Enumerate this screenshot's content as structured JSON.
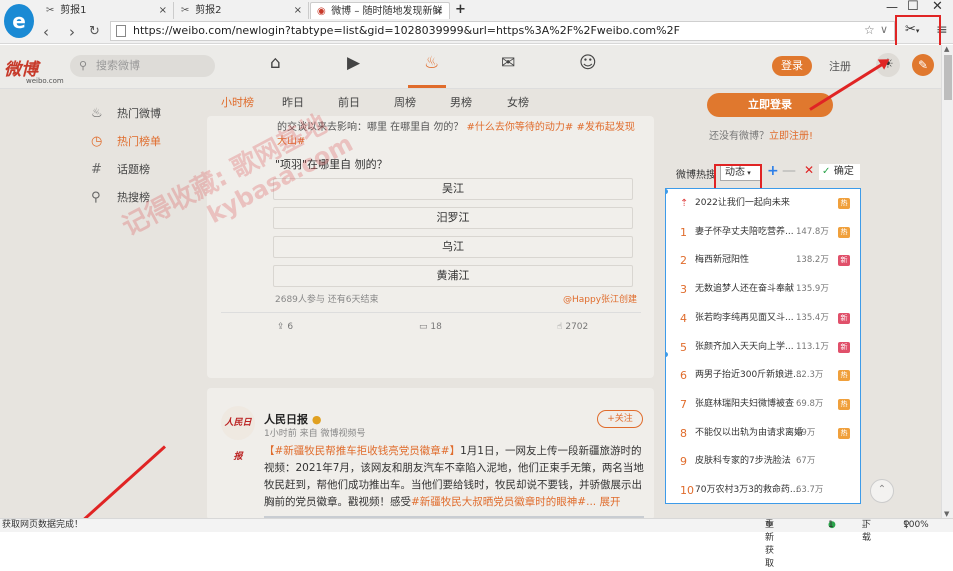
{
  "browser": {
    "tabs": [
      {
        "label": "剪报1",
        "icon": "scissors-icon"
      },
      {
        "label": "剪报2",
        "icon": "scissors-icon"
      },
      {
        "label": "微博 – 随时随地发现新鲜",
        "icon": "weibo-icon"
      }
    ],
    "new_tab": "+",
    "url": "https://weibo.com/newlogin?tabtype=list&gid=1028039999&url=https%3A%2F%2Fweibo.com%2F"
  },
  "weibo": {
    "logo": "微博",
    "logo_sub": "weibo.com",
    "search_placeholder": "搜索微博",
    "login": "登录",
    "register": "注册"
  },
  "sidebar": {
    "items": [
      {
        "label": "热门微博",
        "icon": "fire-icon"
      },
      {
        "label": "热门榜单",
        "icon": "clock-icon"
      },
      {
        "label": "话题榜",
        "icon": "hash-icon"
      },
      {
        "label": "热搜榜",
        "icon": "search-icon"
      }
    ]
  },
  "feed": {
    "tabs": [
      "小时榜",
      "昨日",
      "前日",
      "周榜",
      "男榜",
      "女榜"
    ],
    "poll": {
      "top_line": "的交谈以来去影响：哪里 在哪里自 勿的？",
      "top_line_tag": "#什么去你等待的动力#",
      "top_line_tag2": "#发布起发现",
      "top_line2": "大山#",
      "question": "\"项羽\"在哪里自 刎的？",
      "options": [
        "吴江",
        "汨罗江",
        "乌江",
        "黄浦江"
      ],
      "meta": "2689人参与 还有6天结束",
      "creator": "@Happy张江创建",
      "repost": "6",
      "comment": "18",
      "like": "2702"
    },
    "post": {
      "avatar_text": "人民日报",
      "author": "人民日报",
      "meta": "1小时前 来自 微博视频号",
      "follow": "+关注",
      "text_tag": "【#新疆牧民帮推车拒收钱亮党员徽章#】",
      "text_body": "1月1日，一网友上传一段新疆旅游时的视频：2021年7月，该网友和朋友汽车不幸陷入泥地，他们正束手无策，两名当地牧民赶到，帮他们成功推出车。当他们要给钱时，牧民却说不要钱，并骄傲展示出胸前的党员徽章。戳视频！感受",
      "text_tag2": "#新疆牧民大叔晒党员徽章时的眼神#",
      "more": "... 展开"
    }
  },
  "right": {
    "login_btn": "立即登录",
    "no_account": "还没有微博？",
    "register_link": "立即注册!",
    "hot_title": "微博热搜",
    "dynamic": "动态",
    "confirm": "确定",
    "hot_list": [
      {
        "rank": "",
        "title": "2022让我们一起向未来",
        "count": "",
        "badge": "热"
      },
      {
        "rank": "1",
        "title": "妻子怀孕丈夫陪吃营养...",
        "count": "147.8万",
        "badge": "热"
      },
      {
        "rank": "2",
        "title": "梅西新冠阳性",
        "count": "138.2万",
        "badge": "新"
      },
      {
        "rank": "3",
        "title": "无数追梦人还在奋斗奉献",
        "count": "135.9万",
        "badge": ""
      },
      {
        "rank": "4",
        "title": "张若昀李纯再见面又斗...",
        "count": "135.4万",
        "badge": "新"
      },
      {
        "rank": "5",
        "title": "张颜齐加入天天向上学...",
        "count": "113.1万",
        "badge": "新"
      },
      {
        "rank": "6",
        "title": "两男子抬近300斤新娘进...",
        "count": "82.3万",
        "badge": "热"
      },
      {
        "rank": "7",
        "title": "张庭林瑞阳夫妇微博被查",
        "count": "69.8万",
        "badge": "热"
      },
      {
        "rank": "8",
        "title": "不能仅以出轨为由请求离婚",
        "count": "69万",
        "badge": "热"
      },
      {
        "rank": "9",
        "title": "皮肤科专家的7步洗脸法",
        "count": "67万",
        "badge": ""
      },
      {
        "rank": "10",
        "title": "70万农村3万3的救命药...",
        "count": "63.7万",
        "badge": ""
      }
    ]
  },
  "status": {
    "left": "获取网页数据完成！",
    "refresh": "重新获取",
    "count": "1",
    "download": "下载",
    "zoom": "100%"
  },
  "watermark": {
    "line1": "记得收藏: 歌网基地",
    "line2": "kybasa.com"
  },
  "colors": {
    "accent": "#e0782e",
    "highlight": "#e02424",
    "list_border": "#3d9be9",
    "badge_hot": "#f0a03c",
    "badge_new": "#e0506a"
  }
}
